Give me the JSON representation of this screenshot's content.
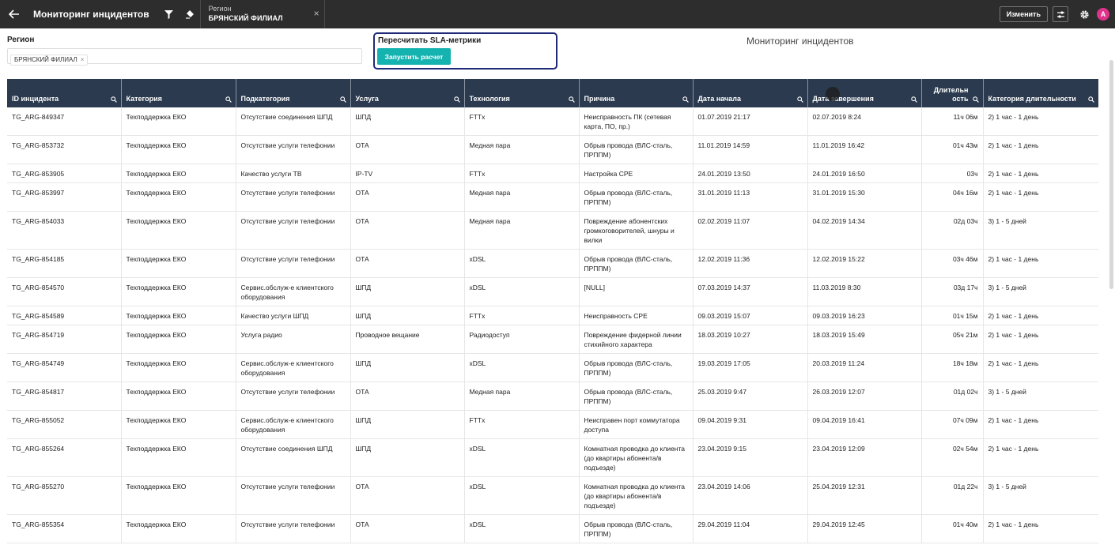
{
  "app": {
    "title": "Мониторинг инцидентов"
  },
  "filter_chip": {
    "label": "Регион",
    "value": "БРЯНСКИЙ ФИЛИАЛ"
  },
  "toolbar": {
    "change_label": "Изменить",
    "avatar_letter": "A"
  },
  "region": {
    "label": "Регион",
    "tag": "БРЯНСКИЙ ФИЛИАЛ"
  },
  "sla": {
    "title": "Пересчитать SLA-метрики",
    "button": "Запустить расчет"
  },
  "dashboard_title": "Мониторинг инцидентов",
  "table": {
    "columns": [
      {
        "label": "ID инцидента"
      },
      {
        "label": "Категория"
      },
      {
        "label": "Подкатегория"
      },
      {
        "label": "Услуга"
      },
      {
        "label": "Технология"
      },
      {
        "label": "Причина"
      },
      {
        "label": "Дата начала"
      },
      {
        "label": "Дата завершения"
      },
      {
        "label": "Длительн ость"
      },
      {
        "label": "Категория длительности"
      }
    ],
    "rows": [
      [
        "TG_ARG-849347",
        "Техподдержка ЕКО",
        "Отсутствие соединения ШПД",
        "ШПД",
        "FTTx",
        "Неисправность ПК (сетевая карта, ПО, пр.)",
        "01.07.2019 21:17",
        "02.07.2019 8:24",
        "11ч 06м",
        "2) 1 час - 1 день"
      ],
      [
        "TG_ARG-853732",
        "Техподдержка ЕКО",
        "Отсутствие услуги телефонии",
        "ОТА",
        "Медная пара",
        "Обрыв провода (ВЛС-сталь, ПРППМ)",
        "11.01.2019 14:59",
        "11.01.2019 16:42",
        "01ч 43м",
        "2) 1 час - 1 день"
      ],
      [
        "TG_ARG-853905",
        "Техподдержка ЕКО",
        "Качество услуги ТВ",
        "IP-TV",
        "FTTx",
        "Настройка CPE",
        "24.01.2019 13:50",
        "24.01.2019 16:50",
        "03ч",
        "2) 1 час - 1 день"
      ],
      [
        "TG_ARG-853997",
        "Техподдержка ЕКО",
        "Отсутствие услуги телефонии",
        "ОТА",
        "Медная пара",
        "Обрыв провода (ВЛС-сталь, ПРППМ)",
        "31.01.2019 11:13",
        "31.01.2019 15:30",
        "04ч 16м",
        "2) 1 час - 1 день"
      ],
      [
        "TG_ARG-854033",
        "Техподдержка ЕКО",
        "Отсутствие услуги телефонии",
        "ОТА",
        "Медная пара",
        "Повреждение абонентских громкоговорителей, шнуры и вилки",
        "02.02.2019 11:07",
        "04.02.2019 14:34",
        "02д 03ч",
        "3) 1 - 5 дней"
      ],
      [
        "TG_ARG-854185",
        "Техподдержка ЕКО",
        "Отсутствие услуги телефонии",
        "ОТА",
        "xDSL",
        "Обрыв провода (ВЛС-сталь, ПРППМ)",
        "12.02.2019 11:36",
        "12.02.2019 15:22",
        "03ч 46м",
        "2) 1 час - 1 день"
      ],
      [
        "TG_ARG-854570",
        "Техподдержка ЕКО",
        "Сервис.обслуж-е клиентского оборудования",
        "ШПД",
        "xDSL",
        "[NULL]",
        "07.03.2019 14:37",
        "11.03.2019 8:30",
        "03д 17ч",
        "3) 1 - 5 дней"
      ],
      [
        "TG_ARG-854589",
        "Техподдержка ЕКО",
        "Качество услуги ШПД",
        "ШПД",
        "FTTx",
        "Неисправность CPE",
        "09.03.2019 15:07",
        "09.03.2019 16:23",
        "01ч 15м",
        "2) 1 час - 1 день"
      ],
      [
        "TG_ARG-854719",
        "Техподдержка ЕКО",
        "Услуга радио",
        "Проводное вещание",
        "Радиодоступ",
        "Повреждение фидерной линии стихийного характера",
        "18.03.2019 10:27",
        "18.03.2019 15:49",
        "05ч 21м",
        "2) 1 час - 1 день"
      ],
      [
        "TG_ARG-854749",
        "Техподдержка ЕКО",
        "Сервис.обслуж-е клиентского оборудования",
        "ШПД",
        "xDSL",
        "Обрыв провода (ВЛС-сталь, ПРППМ)",
        "19.03.2019 17:05",
        "20.03.2019 11:24",
        "18ч 18м",
        "2) 1 час - 1 день"
      ],
      [
        "TG_ARG-854817",
        "Техподдержка ЕКО",
        "Отсутствие услуги телефонии",
        "ОТА",
        "Медная пара",
        "Обрыв провода (ВЛС-сталь, ПРППМ)",
        "25.03.2019 9:47",
        "26.03.2019 12:07",
        "01д 02ч",
        "3) 1 - 5 дней"
      ],
      [
        "TG_ARG-855052",
        "Техподдержка ЕКО",
        "Сервис.обслуж-е клиентского оборудования",
        "ШПД",
        "FTTx",
        "Неисправен порт коммутатора доступа",
        "09.04.2019 9:31",
        "09.04.2019 16:41",
        "07ч 09м",
        "2) 1 час - 1 день"
      ],
      [
        "TG_ARG-855264",
        "Техподдержка ЕКО",
        "Отсутствие соединения ШПД",
        "ШПД",
        "xDSL",
        "Комнатная проводка до клиента (до квартиры абонента/в подъезде)",
        "23.04.2019 9:15",
        "23.04.2019 12:09",
        "02ч 54м",
        "2) 1 час - 1 день"
      ],
      [
        "TG_ARG-855270",
        "Техподдержка ЕКО",
        "Отсутствие услуги телефонии",
        "ОТА",
        "xDSL",
        "Комнатная проводка до клиента (до квартиры абонента/в подъезде)",
        "23.04.2019 14:06",
        "25.04.2019 12:31",
        "01д 22ч",
        "3) 1 - 5 дней"
      ],
      [
        "TG_ARG-855354",
        "Техподдержка ЕКО",
        "Отсутствие услуги телефонии",
        "ОТА",
        "xDSL",
        "Обрыв провода (ВЛС-сталь, ПРППМ)",
        "29.04.2019 11:04",
        "29.04.2019 12:45",
        "01ч 40м",
        "2) 1 час - 1 день"
      ]
    ]
  },
  "colors": {
    "topbar": "#2d2d2d",
    "header": "#2b3a4e",
    "accent": "#15b3b0",
    "panel_border": "#1e2a78",
    "avatar": "#e0328a"
  }
}
